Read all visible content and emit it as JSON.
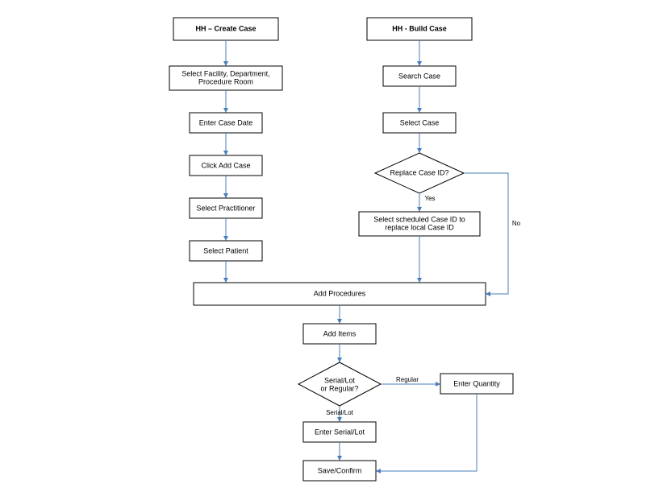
{
  "nodes": {
    "createHeader": "HH – Create Case",
    "buildHeader": "HH - Build Case",
    "selectFacility1": "Select Facility, Department,",
    "selectFacility2": "Procedure Room",
    "enterCaseDate": "Enter Case Date",
    "clickAddCase": "Click Add Case",
    "selectPractitioner": "Select Practitioner",
    "selectPatient": "Select Patient",
    "searchCase": "Search Case",
    "selectCase": "Select Case",
    "replaceCaseId": "Replace Case ID?",
    "selectScheduled1": "Select scheduled Case ID to",
    "selectScheduled2": "replace local Case ID",
    "addProcedures": "Add Procedures",
    "addItems": "Add Items",
    "serialLot1": "Serial/Lot",
    "serialLot2": "or Regular?",
    "enterQuantity": "Enter Quantity",
    "enterSerialLot": "Enter Serial/Lot",
    "saveConfirm": "Save/Confirm"
  },
  "edges": {
    "yes": "Yes",
    "no": "No",
    "regular": "Regular",
    "serialLot": "Serial/Lot"
  }
}
